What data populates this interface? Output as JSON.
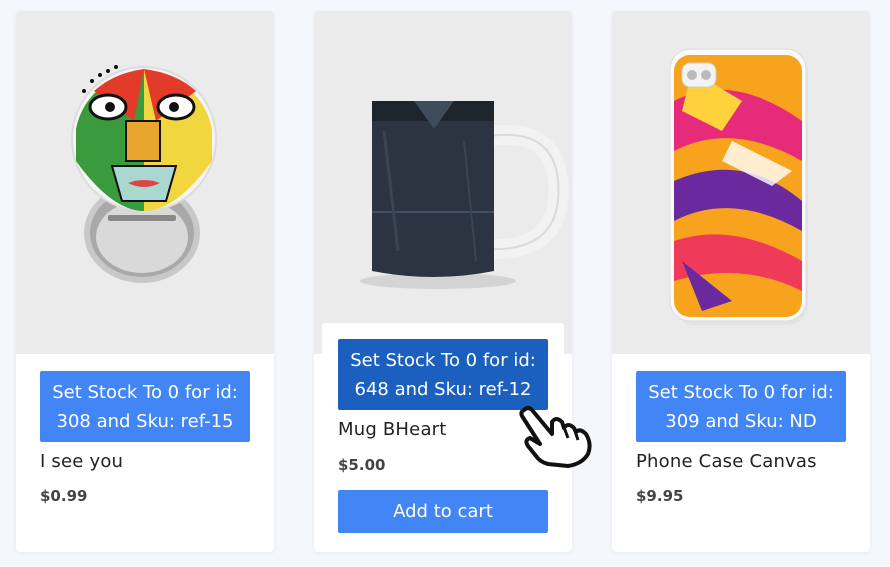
{
  "products": [
    {
      "name": "I see you",
      "price": "$0.99",
      "set_stock_line1": "Set Stock To 0 for id:",
      "set_stock_line2": "308 and Sku: ref-15",
      "image_icon": "badge-button-image"
    },
    {
      "name": "Mug BHeart",
      "price": "$5.00",
      "set_stock_line1": "Set Stock To 0 for id:",
      "set_stock_line2": "648 and Sku: ref-12",
      "add_to_cart": "Add to cart",
      "image_icon": "mug-image"
    },
    {
      "name": "Phone Case Canvas",
      "price": "$9.95",
      "set_stock_line1": "Set Stock To 0 for id:",
      "set_stock_line2": "309 and Sku: ND",
      "image_icon": "phone-case-image"
    }
  ],
  "colors": {
    "button": "#4285f4",
    "button_hover": "#1b5fbf",
    "image_bg": "#ebebeb",
    "page_bg": "#f4f7fb"
  },
  "cursor_icon": "hand-pointer-icon"
}
